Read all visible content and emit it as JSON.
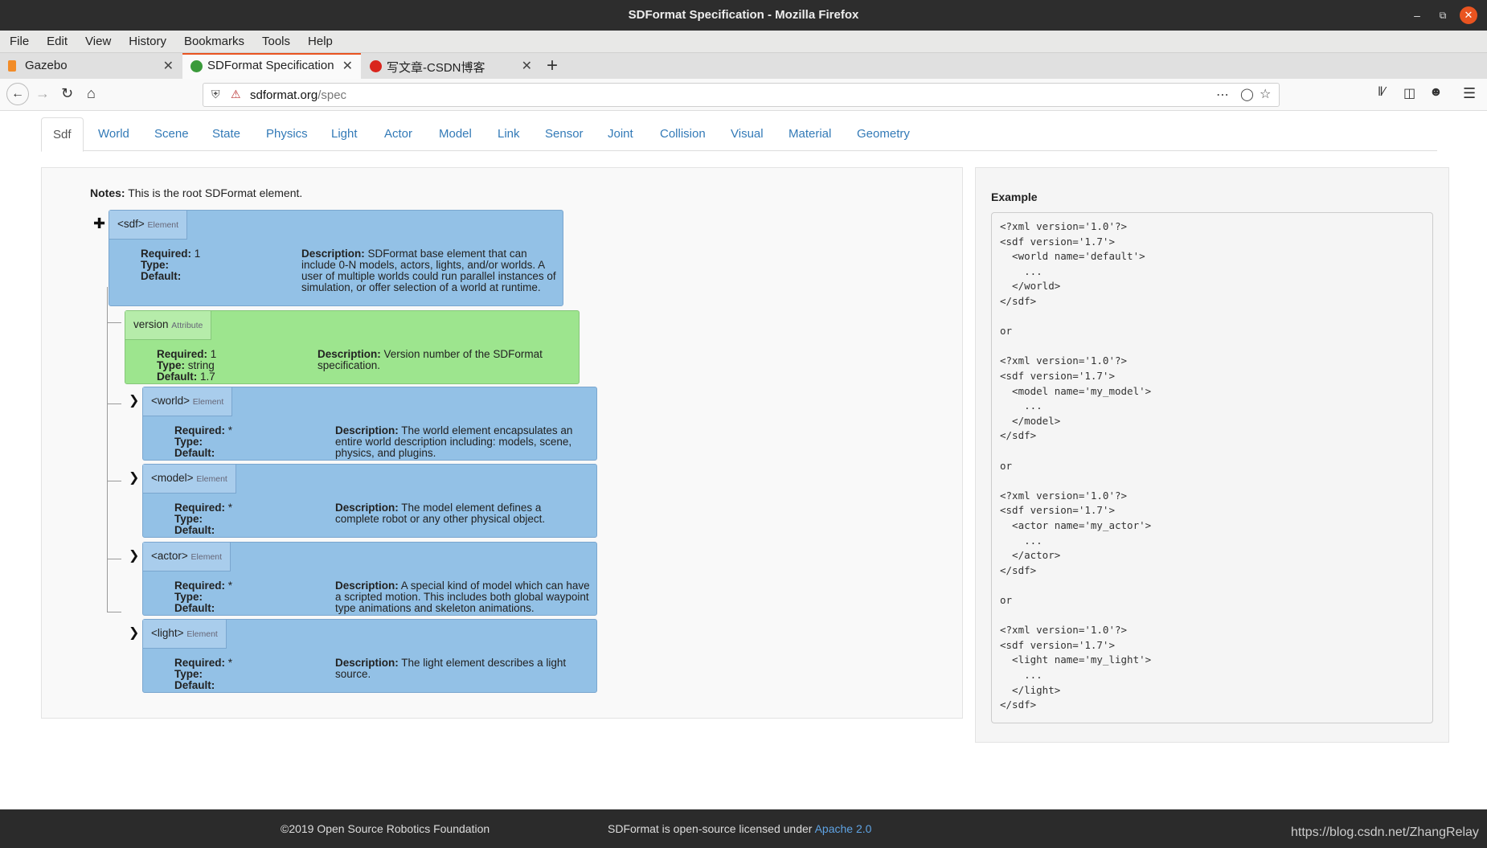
{
  "window": {
    "title": "SDFormat Specification - Mozilla Firefox"
  },
  "menu": [
    "File",
    "Edit",
    "View",
    "History",
    "Bookmarks",
    "Tools",
    "Help"
  ],
  "tabs": [
    {
      "label": "Gazebo",
      "icon": "gazebo-icon",
      "active": false
    },
    {
      "label": "SDFormat Specification",
      "icon": "sdformat-icon",
      "active": true
    },
    {
      "label": "写文章-CSDN博客",
      "icon": "csdn-icon",
      "active": false
    }
  ],
  "urlbar": {
    "host": "sdformat.org",
    "path": "/spec"
  },
  "nav_tabs": [
    "Sdf",
    "World",
    "Scene",
    "State",
    "Physics",
    "Light",
    "Actor",
    "Model",
    "Link",
    "Sensor",
    "Joint",
    "Collision",
    "Visual",
    "Material",
    "Geometry"
  ],
  "notes": {
    "label": "Notes:",
    "text": " This is the root SDFormat element."
  },
  "labels": {
    "required": "Required:",
    "type": "Type:",
    "default": "Default:",
    "description": "Description:"
  },
  "elements": [
    {
      "name": "<sdf>",
      "kind": "Element",
      "required": "1",
      "type": "",
      "default": "",
      "description": "SDFormat base element that can include 0-N models, actors, lights, and/or worlds. A user of multiple worlds could run parallel instances of simulation, or offer selection of a world at runtime."
    },
    {
      "name": "version",
      "kind": "Attribute",
      "required": "1",
      "type": "string",
      "default": "1.7",
      "description": "Version number of the SDFormat specification."
    },
    {
      "name": "<world>",
      "kind": "Element",
      "required": "*",
      "type": "",
      "default": "",
      "description": "The world element encapsulates an entire world description including: models, scene, physics, and plugins."
    },
    {
      "name": "<model>",
      "kind": "Element",
      "required": "*",
      "type": "",
      "default": "",
      "description": "The model element defines a complete robot or any other physical object."
    },
    {
      "name": "<actor>",
      "kind": "Element",
      "required": "*",
      "type": "",
      "default": "",
      "description": "A special kind of model which can have a scripted motion. This includes both global waypoint type animations and skeleton animations."
    },
    {
      "name": "<light>",
      "kind": "Element",
      "required": "*",
      "type": "",
      "default": "",
      "description": "The light element describes a light source."
    }
  ],
  "example": {
    "title": "Example",
    "lines": [
      "<?xml version='1.0'?>",
      "<sdf version='1.7'>",
      "  <world name='default'>",
      "    ...",
      "  </world>",
      "</sdf>",
      "",
      "or",
      "",
      "<?xml version='1.0'?>",
      "<sdf version='1.7'>",
      "  <model name='my_model'>",
      "    ...",
      "  </model>",
      "</sdf>",
      "",
      "or",
      "",
      "<?xml version='1.0'?>",
      "<sdf version='1.7'>",
      "  <actor name='my_actor'>",
      "    ...",
      "  </actor>",
      "</sdf>",
      "",
      "or",
      "",
      "<?xml version='1.0'?>",
      "<sdf version='1.7'>",
      "  <light name='my_light'>",
      "    ...",
      "  </light>",
      "</sdf>"
    ]
  },
  "footer": {
    "copyright": "©2019 Open Source Robotics Foundation",
    "license_prefix": "SDFormat is open-source licensed under ",
    "license_link": "Apache 2.0",
    "watermark": "https://blog.csdn.net/ZhangRelay"
  },
  "colors": {
    "accent": "#e95420",
    "link": "#337ab7",
    "element_bg": "#93c1e6",
    "attribute_bg": "#9de58e"
  }
}
